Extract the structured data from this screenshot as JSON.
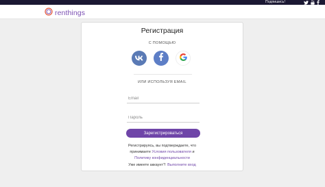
{
  "topbar": {
    "subscribe_label": "Подпишись!",
    "icons": [
      "twitter-icon",
      "youtube-icon",
      "facebook-icon"
    ]
  },
  "header": {
    "logo_text": "renthings"
  },
  "colors": {
    "brand": "#7b4fb3",
    "button": "#6f45a8",
    "topbar": "#1b1833",
    "vk": "#5a7ab5",
    "facebook": "#5d7ec6"
  },
  "card": {
    "title": "Регистрация",
    "with_help": "С ПОМОЩЬЮ",
    "social_buttons": [
      "vk-icon",
      "facebook-icon",
      "google-icon"
    ],
    "or_email": "ИЛИ ИСПОЛЬЗУЯ EMAIL",
    "email_placeholder": "Email",
    "password_placeholder": "Пароль",
    "register_button": "Зарегистрироваться",
    "terms_line1": "Регистрируясь, вы подтверждаете, что",
    "terms_line2_prefix": "принимаете ",
    "terms_link1": "Условия пользователя",
    "terms_line2_suffix": " и",
    "terms_link2": "Политику конфиденциальности",
    "have_account": "Уже имеете аккаунт?: ",
    "login_link": "Выполните вход"
  }
}
